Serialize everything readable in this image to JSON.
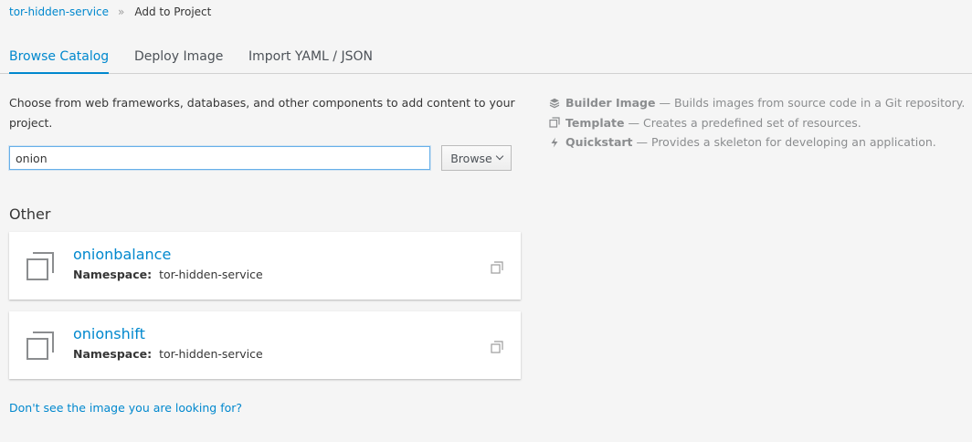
{
  "breadcrumb": {
    "project": "tor-hidden-service",
    "separator": "»",
    "current": "Add to Project"
  },
  "tabs": [
    {
      "label": "Browse Catalog",
      "active": true
    },
    {
      "label": "Deploy Image",
      "active": false
    },
    {
      "label": "Import YAML / JSON",
      "active": false
    }
  ],
  "intro": "Choose from web frameworks, databases, and other components to add content to your project.",
  "search": {
    "value": "onion",
    "placeholder": ""
  },
  "browse_button": {
    "label": "Browse",
    "icon": "chevron-down-icon"
  },
  "legend": [
    {
      "icon": "builder-image-icon",
      "name": "Builder Image",
      "desc": "— Builds images from source code in a Git repository."
    },
    {
      "icon": "template-icon",
      "name": "Template",
      "desc": "— Creates a predefined set of resources."
    },
    {
      "icon": "quickstart-icon",
      "name": "Quickstart",
      "desc": "— Provides a skeleton for developing an application."
    }
  ],
  "section": {
    "title": "Other"
  },
  "results": [
    {
      "title": "onionbalance",
      "namespace_label": "Namespace:",
      "namespace": "tor-hidden-service",
      "icon": "template-icon"
    },
    {
      "title": "onionshift",
      "namespace_label": "Namespace:",
      "namespace": "tor-hidden-service",
      "icon": "template-icon"
    }
  ],
  "footer_link": "Don't see the image you are looking for?",
  "colors": {
    "link": "#0088ce",
    "background": "#f5f5f5",
    "muted": "#8b8d8f"
  }
}
